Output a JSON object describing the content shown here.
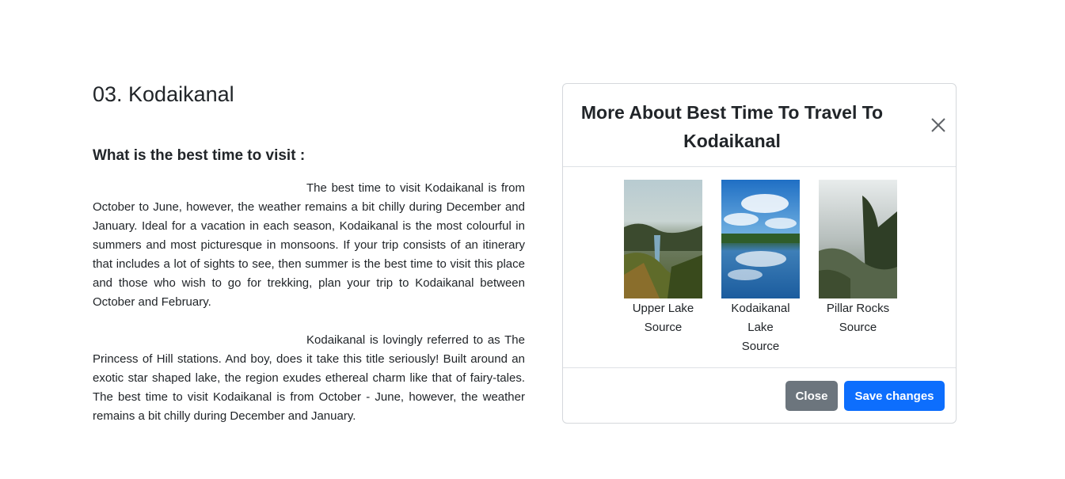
{
  "article": {
    "title": "03. Kodaikanal",
    "subtitle": "What is the best time to visit :",
    "paragraph1": "The best time to visit Kodaikanal is from October to June, however, the weather remains a bit chilly during December and January. Ideal for a vacation in each season, Kodaikanal is the most colourful in summers and most picturesque in monsoons. If your trip consists of an itinerary that includes a lot of sights to see, then summer is the best time to visit this place and those who wish to go for trekking, plan your trip to Kodaikanal between October and February.",
    "paragraph2": "Kodaikanal is lovingly referred to as The Princess of Hill stations. And boy, does it take this title seriously! Built around an exotic star shaped lake, the region exudes ethereal charm like that of fairy-tales. The best time to visit Kodaikanal is from October - June, however, the weather remains a bit chilly during December and January."
  },
  "modal": {
    "title": "More About Best Time To Travel To Kodaikanal",
    "close_icon": "close-x-icon",
    "images": [
      {
        "caption_line1": "Upper Lake",
        "caption_line2": "Source"
      },
      {
        "caption_line1": "Kodaikanal",
        "caption_line1b": "Lake",
        "caption_line2": "Source"
      },
      {
        "caption_line1": "Pillar Rocks",
        "caption_line2": "Source"
      }
    ],
    "buttons": {
      "close_label": "Close",
      "save_label": "Save changes"
    }
  },
  "colors": {
    "close_button": "#6c757d",
    "save_button": "#0d6efd"
  }
}
